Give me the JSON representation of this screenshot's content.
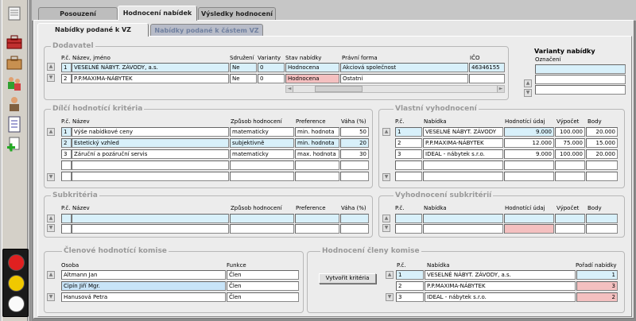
{
  "tabs": [
    "Posouzení",
    "Hodnocení nabídek",
    "Výsledky hodnocení"
  ],
  "subtabs": [
    "Nabídky podané k VZ",
    "Nabídky podané k částem VZ"
  ],
  "dodavatel": {
    "legend": "Dodavatel",
    "headers": {
      "pc": "P.č.",
      "nazev": "Název, jméno",
      "sdruzeni": "Sdružení",
      "varianty": "Varianty",
      "stav": "Stav nabídky",
      "forma": "Právní forma",
      "ico": "IČO"
    },
    "rows": [
      {
        "pc": "1",
        "nazev": "VESELNÉ NÁBYT. ZÁVODY, a.s.",
        "sdruzeni": "Ne",
        "varianty": "0",
        "stav": "Hodnocena",
        "forma": "Akciová společnost",
        "ico": "46346155"
      },
      {
        "pc": "2",
        "nazev": "P.P.MAXIMA-NÁBYTEK",
        "sdruzeni": "Ne",
        "varianty": "0",
        "stav": "Hodnocena",
        "forma": "Ostatní",
        "ico": ""
      }
    ]
  },
  "varianty": {
    "title": "Varianty nabídky",
    "header": "Označení"
  },
  "kriteria": {
    "legend": "Dílčí hodnotící kritéria",
    "headers": {
      "pc": "P.č.",
      "nazev": "Název",
      "zpusob": "Způsob hodnocení",
      "pref": "Preference",
      "vaha": "Váha (%)"
    },
    "rows": [
      {
        "pc": "1",
        "nazev": "Výše nabídkové ceny",
        "zpusob": "matematicky",
        "pref": "min. hodnota",
        "vaha": "50"
      },
      {
        "pc": "2",
        "nazev": "Estetický vzhled",
        "zpusob": "subjektivně",
        "pref": "min. hodnota",
        "vaha": "20"
      },
      {
        "pc": "3",
        "nazev": "Záruční a pozáruční servis",
        "zpusob": "matematicky",
        "pref": "max. hodnota",
        "vaha": "30"
      }
    ]
  },
  "vlastni": {
    "legend": "Vlastní vyhodnocení",
    "headers": {
      "pc": "P.č.",
      "nabidka": "Nabídka",
      "udaj": "Hodnotící údaj",
      "vypocet": "Výpočet",
      "body": "Body"
    },
    "rows": [
      {
        "pc": "1",
        "nabidka": "VESELNÉ NÁBYT. ZÁVODY",
        "udaj": "9.000",
        "vypocet": "100.000",
        "body": "20.000"
      },
      {
        "pc": "2",
        "nabidka": "P.P.MAXIMA-NÁBYTEK",
        "udaj": "12.000",
        "vypocet": "75.000",
        "body": "15.000"
      },
      {
        "pc": "3",
        "nabidka": "IDEAL - nábytek s.r.o.",
        "udaj": "9.000",
        "vypocet": "100.000",
        "body": "20.000"
      }
    ]
  },
  "subkriteria": {
    "legend": "Subkritéria",
    "headers": {
      "pc": "P.č.",
      "nazev": "Název",
      "zpusob": "Způsob hodnocení",
      "pref": "Preference",
      "vaha": "Váha (%)"
    }
  },
  "vyhodnoceni_sub": {
    "legend": "Vyhodnocení subkritérií",
    "headers": {
      "pc": "P.č.",
      "nabidka": "Nabídka",
      "udaj": "Hodnotící údaj",
      "vypocet": "Výpočet",
      "body": "Body"
    }
  },
  "komise": {
    "legend": "Členové hodnotící komise",
    "headers": {
      "osoba": "Osoba",
      "funkce": "Funkce"
    },
    "rows": [
      {
        "osoba": "Altmann Jan",
        "funkce": "Člen"
      },
      {
        "osoba": "Cipín Jiří Mgr.",
        "funkce": "Člen"
      },
      {
        "osoba": "Hanusová Petra",
        "funkce": "Člen"
      }
    ]
  },
  "clenem": {
    "legend": "Hodnocení členy komise",
    "button": "Vytvořit kritéria",
    "headers": {
      "pc": "P.č.",
      "nabidka": "Nabídka",
      "poradi": "Pořadí nabídky"
    },
    "rows": [
      {
        "pc": "1",
        "nabidka": "VESELNÉ NÁBYT. ZÁVODY, a.s.",
        "poradi": "1"
      },
      {
        "pc": "2",
        "nabidka": "P.P.MAXIMA-NÁBYTEK",
        "poradi": "3"
      },
      {
        "pc": "3",
        "nabidka": "IDEAL - nábytek s.r.o.",
        "poradi": "2"
      }
    ]
  },
  "toolbar_icons": [
    "document-icon",
    "toolbox-icon",
    "briefcase-icon",
    "people-icon",
    "person-icon",
    "checklist-icon",
    "add-document-icon"
  ],
  "traffic_light": [
    "red",
    "yellow",
    "white"
  ]
}
